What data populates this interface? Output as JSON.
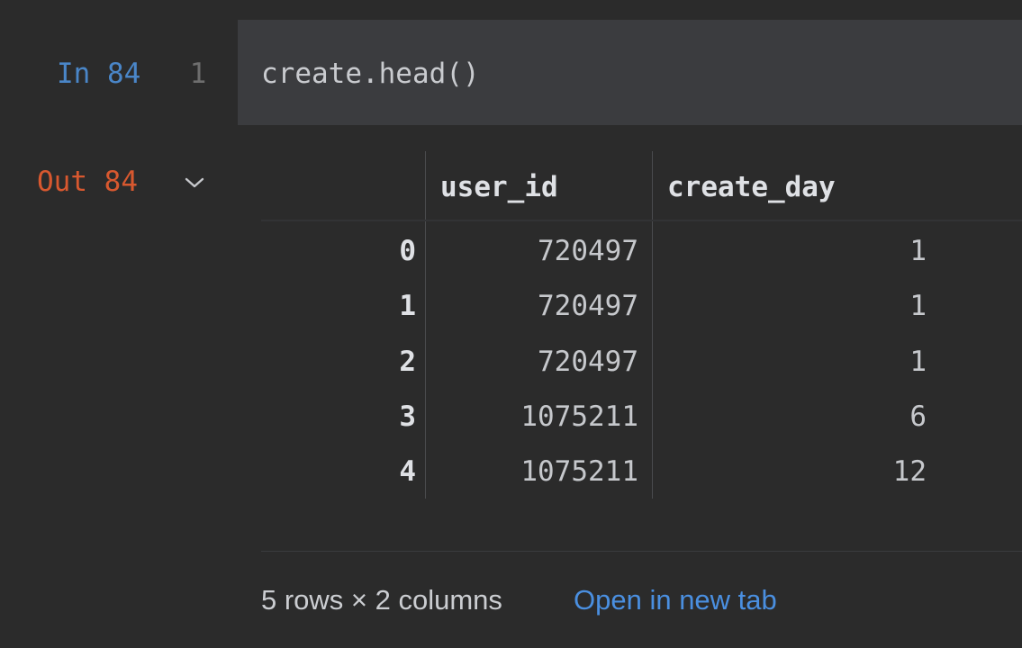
{
  "input_cell": {
    "label": "In 84",
    "line_number": "1",
    "code": "create.head()"
  },
  "output_cell": {
    "label": "Out 84",
    "toggle_icon": "chevron-down-icon"
  },
  "dataframe": {
    "columns": [
      "user_id",
      "create_day"
    ],
    "rows": [
      {
        "index": "0",
        "user_id": "720497",
        "create_day": "1"
      },
      {
        "index": "1",
        "user_id": "720497",
        "create_day": "1"
      },
      {
        "index": "2",
        "user_id": "720497",
        "create_day": "1"
      },
      {
        "index": "3",
        "user_id": "1075211",
        "create_day": "6"
      },
      {
        "index": "4",
        "user_id": "1075211",
        "create_day": "12"
      }
    ]
  },
  "footer": {
    "summary": "5 rows × 2 columns",
    "open_link": "Open in new tab"
  },
  "colors": {
    "background": "#2b2b2b",
    "code_background": "#3b3c3f",
    "in_label": "#4a86c8",
    "out_label": "#d8582f",
    "link": "#4a8fe0"
  }
}
